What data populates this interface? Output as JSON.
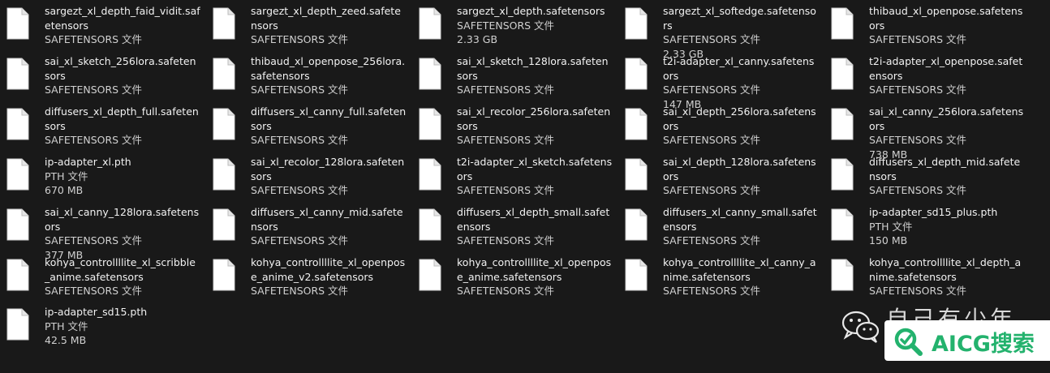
{
  "files": [
    {
      "name": "sargezt_xl_depth_faid_vidit.safetensors",
      "type": "SAFETENSORS 文件",
      "size": ""
    },
    {
      "name": "sargezt_xl_depth_zeed.safetensors",
      "type": "SAFETENSORS 文件",
      "size": ""
    },
    {
      "name": "sargezt_xl_depth.safetensors",
      "type": "SAFETENSORS 文件",
      "size": "2.33 GB"
    },
    {
      "name": "sargezt_xl_softedge.safetensors",
      "type": "SAFETENSORS 文件",
      "size": "2.33 GB"
    },
    {
      "name": "thibaud_xl_openpose.safetensors",
      "type": "SAFETENSORS 文件",
      "size": ""
    },
    {
      "name": "sai_xl_sketch_256lora.safetensors",
      "type": "SAFETENSORS 文件",
      "size": ""
    },
    {
      "name": "thibaud_xl_openpose_256lora.safetensors",
      "type": "SAFETENSORS 文件",
      "size": ""
    },
    {
      "name": "sai_xl_sketch_128lora.safetensors",
      "type": "SAFETENSORS 文件",
      "size": ""
    },
    {
      "name": "t2i-adapter_xl_canny.safetensors",
      "type": "SAFETENSORS 文件",
      "size": "147 MB"
    },
    {
      "name": "t2i-adapter_xl_openpose.safetensors",
      "type": "SAFETENSORS 文件",
      "size": ""
    },
    {
      "name": "diffusers_xl_depth_full.safetensors",
      "type": "SAFETENSORS 文件",
      "size": ""
    },
    {
      "name": "diffusers_xl_canny_full.safetensors",
      "type": "SAFETENSORS 文件",
      "size": ""
    },
    {
      "name": "sai_xl_recolor_256lora.safetensors",
      "type": "SAFETENSORS 文件",
      "size": ""
    },
    {
      "name": "sai_xl_depth_256lora.safetensors",
      "type": "SAFETENSORS 文件",
      "size": ""
    },
    {
      "name": "sai_xl_canny_256lora.safetensors",
      "type": "SAFETENSORS 文件",
      "size": "738 MB"
    },
    {
      "name": "ip-adapter_xl.pth",
      "type": "PTH 文件",
      "size": "670 MB"
    },
    {
      "name": "sai_xl_recolor_128lora.safetensors",
      "type": "SAFETENSORS 文件",
      "size": ""
    },
    {
      "name": "t2i-adapter_xl_sketch.safetensors",
      "type": "SAFETENSORS 文件",
      "size": ""
    },
    {
      "name": "sai_xl_depth_128lora.safetensors",
      "type": "SAFETENSORS 文件",
      "size": ""
    },
    {
      "name": "diffusers_xl_depth_mid.safetensors",
      "type": "SAFETENSORS 文件",
      "size": ""
    },
    {
      "name": "sai_xl_canny_128lora.safetensors",
      "type": "SAFETENSORS 文件",
      "size": "377 MB"
    },
    {
      "name": "diffusers_xl_canny_mid.safetensors",
      "type": "SAFETENSORS 文件",
      "size": ""
    },
    {
      "name": "diffusers_xl_depth_small.safetensors",
      "type": "SAFETENSORS 文件",
      "size": ""
    },
    {
      "name": "diffusers_xl_canny_small.safetensors",
      "type": "SAFETENSORS 文件",
      "size": ""
    },
    {
      "name": "ip-adapter_sd15_plus.pth",
      "type": "PTH 文件",
      "size": "150 MB"
    },
    {
      "name": "kohya_controllllite_xl_scribble_anime.safetensors",
      "type": "SAFETENSORS 文件",
      "size": ""
    },
    {
      "name": "kohya_controllllite_xl_openpose_anime_v2.safetensors",
      "type": "SAFETENSORS 文件",
      "size": ""
    },
    {
      "name": "kohya_controllllite_xl_openpose_anime.safetensors",
      "type": "SAFETENSORS 文件",
      "size": ""
    },
    {
      "name": "kohya_controllllite_xl_canny_anime.safetensors",
      "type": "SAFETENSORS 文件",
      "size": ""
    },
    {
      "name": "kohya_controllllite_xl_depth_anime.safetensors",
      "type": "SAFETENSORS 文件",
      "size": ""
    },
    {
      "name": "ip-adapter_sd15.pth",
      "type": "PTH 文件",
      "size": "42.5 MB"
    }
  ],
  "watermark": {
    "text": "AICG搜索",
    "ghost_text": "自己有少年",
    "color": "#23b26d"
  },
  "colors": {
    "background": "#191919",
    "name_text": "#f2f2f2",
    "meta_text": "#d0d0d0"
  }
}
